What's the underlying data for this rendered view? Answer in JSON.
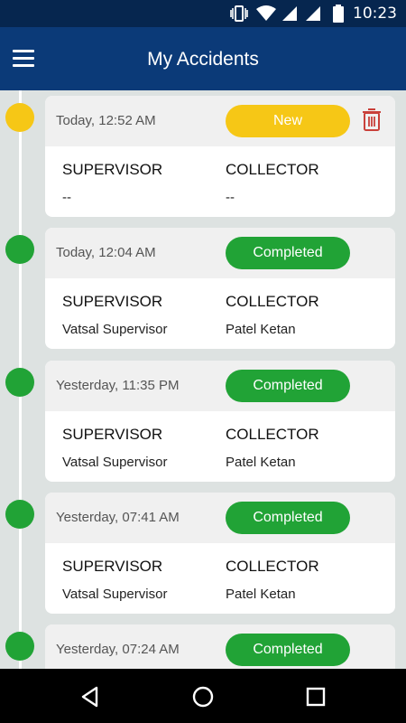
{
  "status_bar": {
    "time": "10:23"
  },
  "app_bar": {
    "title": "My Accidents"
  },
  "colors": {
    "new": "#f6c716",
    "completed": "#21a336",
    "header": "#0b3a78",
    "status_bar": "#06264f"
  },
  "labels": {
    "supervisor": "SUPERVISOR",
    "collector": "COLLECTOR"
  },
  "accidents": [
    {
      "date": "Today, 12:52 AM",
      "status": "New",
      "supervisor": "--",
      "collector": "--",
      "deletable": true
    },
    {
      "date": "Today, 12:04 AM",
      "status": "Completed",
      "supervisor": "Vatsal Supervisor",
      "collector": "Patel Ketan",
      "deletable": false
    },
    {
      "date": "Yesterday, 11:35 PM",
      "status": "Completed",
      "supervisor": "Vatsal Supervisor",
      "collector": "Patel Ketan",
      "deletable": false
    },
    {
      "date": "Yesterday, 07:41 AM",
      "status": "Completed",
      "supervisor": "Vatsal Supervisor",
      "collector": "Patel Ketan",
      "deletable": false
    },
    {
      "date": "Yesterday, 07:24 AM",
      "status": "Completed",
      "supervisor": "",
      "collector": "",
      "deletable": false
    }
  ]
}
